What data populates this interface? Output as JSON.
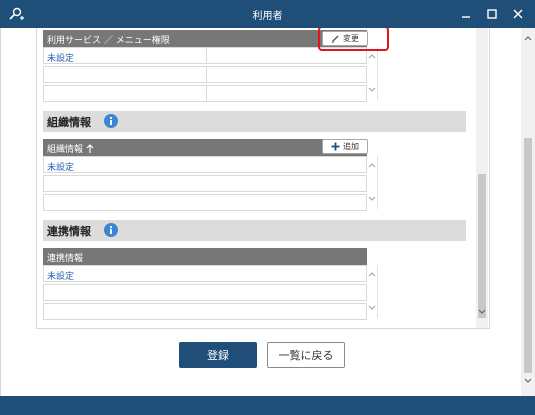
{
  "window": {
    "title": "利用者"
  },
  "section_service": {
    "grid_header": "利用サービス ／ メニュー権限",
    "change_button": "変更",
    "rows": [
      "未設定",
      "",
      ""
    ]
  },
  "section_org": {
    "title": "組織情報",
    "grid_header": "組織情報",
    "add_button": "追加",
    "rows": [
      "未設定",
      "",
      ""
    ]
  },
  "section_link": {
    "title": "連携情報",
    "grid_header": "連携情報",
    "rows": [
      "未設定",
      "",
      ""
    ]
  },
  "footer": {
    "register_button": "登録",
    "back_button": "一覧に戻る"
  },
  "colors": {
    "titlebar": "#1f4e79",
    "link_text": "#2563b0",
    "highlight": "#e0151d"
  }
}
